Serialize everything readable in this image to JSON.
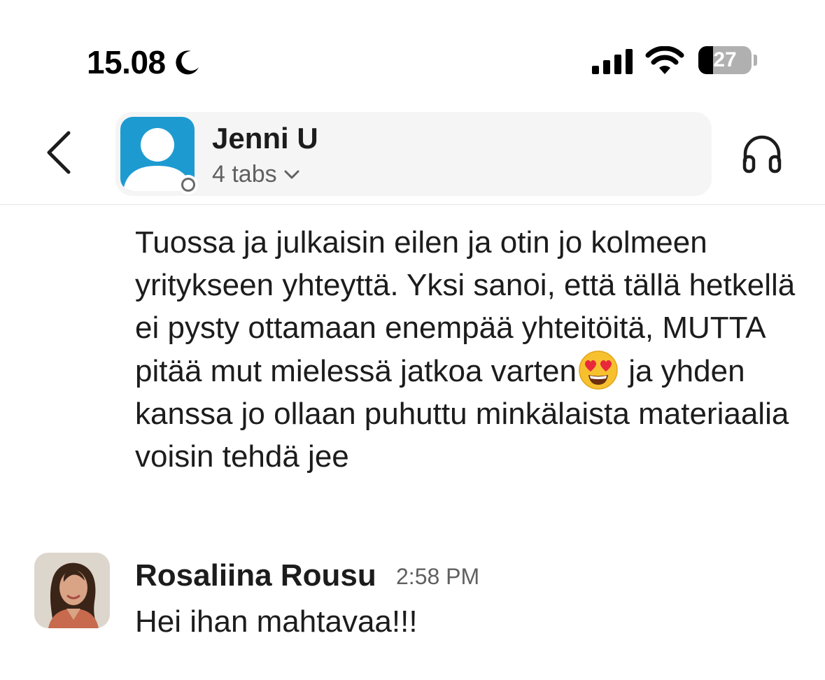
{
  "status_bar": {
    "time": "15.08",
    "battery": "27",
    "battery_level": 0.27,
    "icons": [
      "moon-icon",
      "signal-icon",
      "wifi-icon",
      "battery-icon"
    ]
  },
  "header": {
    "name": "Jenni U",
    "subtitle": "4 tabs",
    "icons": [
      "back-icon",
      "chevron-down-icon",
      "headphones-icon"
    ],
    "avatar_color": "#1d9bd1"
  },
  "messages": [
    {
      "text_before_emoji": "Tuossa ja julkaisin eilen ja otin jo kolmeen yritykseen yhteyttä. Yksi sanoi, että tällä hetkellä ei pysty ottamaan enempää yhteitöitä, MUTTA pitää mut mielessä jatkoa varten",
      "emoji": "heart-eyes-emoji",
      "text_after_emoji": " ja yhden kanssa jo ollaan puhuttu minkälaista materiaalia voisin tehdä jee"
    },
    {
      "sender": "Rosaliina Rousu",
      "time": "2:58 PM",
      "text": "Hei ihan mahtavaa!!!"
    }
  ],
  "colors": {
    "text": "#1d1c1d",
    "secondary_text": "#616061",
    "pill_background": "#f5f5f6"
  }
}
